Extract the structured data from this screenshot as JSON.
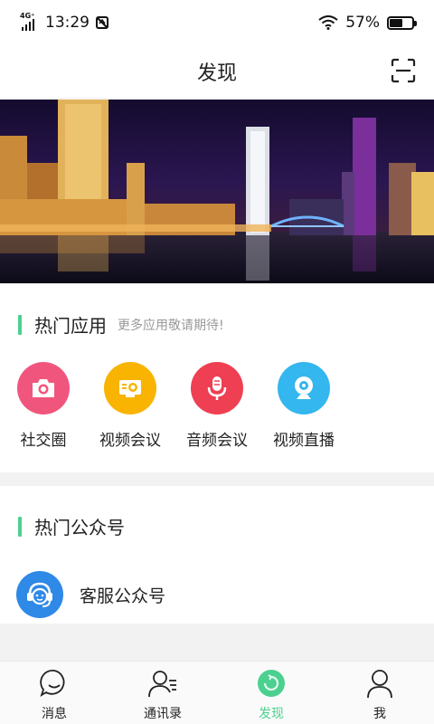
{
  "status_bar": {
    "network": "4G⁺",
    "time": "13:29",
    "battery_percent": "57%",
    "battery_level": 0.57
  },
  "header": {
    "title": "发现"
  },
  "hot_apps": {
    "title": "热门应用",
    "subtitle": "更多应用敬请期待!",
    "items": [
      {
        "label": "社交圈",
        "icon": "camera-icon",
        "color": "#f0567d"
      },
      {
        "label": "视频会议",
        "icon": "video-conference-icon",
        "color": "#f8b400"
      },
      {
        "label": "音频会议",
        "icon": "microphone-icon",
        "color": "#ef3f52"
      },
      {
        "label": "视频直播",
        "icon": "webcam-icon",
        "color": "#34b6ef"
      }
    ]
  },
  "hot_accounts": {
    "title": "热门公众号",
    "items": [
      {
        "name": "客服公众号",
        "icon": "customer-service-icon",
        "color": "#2f89e6"
      }
    ]
  },
  "tabbar": {
    "items": [
      {
        "label": "消息",
        "icon": "message-icon"
      },
      {
        "label": "通讯录",
        "icon": "contacts-icon"
      },
      {
        "label": "发现",
        "icon": "discover-icon",
        "active": true
      },
      {
        "label": "我",
        "icon": "profile-icon"
      }
    ],
    "active_color": "#4cd08f"
  },
  "colors": {
    "accent": "#4cd08f"
  }
}
